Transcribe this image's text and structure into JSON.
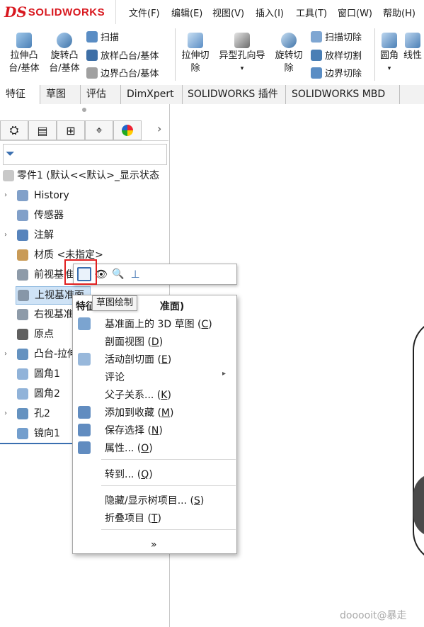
{
  "app": {
    "logo_ds": "DS",
    "logo_text": "SOLIDWORKS",
    "brand_color": "#d8181f"
  },
  "menubar": [
    "文件(F)",
    "编辑(E)",
    "视图(V)",
    "插入(I)",
    "工具(T)",
    "窗口(W)",
    "帮助(H)"
  ],
  "ribbon": {
    "extrude_boss": [
      "拉伸凸",
      "台/基体"
    ],
    "revolve_boss": [
      "旋转凸",
      "台/基体"
    ],
    "sweep": "扫描",
    "loft": "放样凸台/基体",
    "boundary": "边界凸台/基体",
    "extrude_cut": [
      "拉伸切",
      "除"
    ],
    "hole_wizard": "异型孔向导",
    "revolve_cut": [
      "旋转切",
      "除"
    ],
    "sweep_cut": "扫描切除",
    "loft_cut": "放样切割",
    "boundary_cut": "边界切除",
    "fillet": "圆角",
    "linear_pattern": "线性"
  },
  "tabs": [
    "特征",
    "草图",
    "评估",
    "DimXpert",
    "SOLIDWORKS 插件",
    "SOLIDWORKS MBD"
  ],
  "tree": {
    "root": "零件1  (默认<<默认>_显示状态",
    "items": [
      {
        "label": "History",
        "arrow": "›"
      },
      {
        "label": "传感器",
        "arrow": ""
      },
      {
        "label": "注解",
        "arrow": "›"
      },
      {
        "label": "材质 <未指定>",
        "arrow": ""
      },
      {
        "label": "前视基准",
        "arrow": ""
      },
      {
        "label": "上视基准面",
        "arrow": ""
      },
      {
        "label": "右视基准",
        "arrow": ""
      },
      {
        "label": "原点",
        "arrow": ""
      },
      {
        "label": "凸台-拉伸",
        "arrow": "›"
      },
      {
        "label": "圆角1",
        "arrow": ""
      },
      {
        "label": "圆角2",
        "arrow": ""
      },
      {
        "label": "孔2",
        "arrow": "›"
      },
      {
        "label": "镜向1",
        "arrow": ""
      }
    ]
  },
  "tooltip": "草图绘制",
  "menu": {
    "header_prefix": "特征",
    "header_suffix": "准面)",
    "items": [
      {
        "label": "基准面上的 3D 草图 (",
        "key": "C",
        "tail": ")",
        "icon": "3d-sketch-icon"
      },
      {
        "label": "剖面视图 (",
        "key": "D",
        "tail": ")",
        "icon": ""
      },
      {
        "label": "活动剖切面 (",
        "key": "E",
        "tail": ")",
        "icon": "section-plane-icon"
      },
      {
        "label": "评论",
        "key": "",
        "tail": "",
        "icon": ""
      },
      {
        "label": "父子关系... (",
        "key": "K",
        "tail": ")",
        "icon": ""
      },
      {
        "label": "添加到收藏 (",
        "key": "M",
        "tail": ")",
        "icon": "favorite-icon"
      },
      {
        "label": "保存选择 (",
        "key": "N",
        "tail": ")",
        "icon": "save-selection-icon"
      },
      {
        "label": "属性... (",
        "key": "O",
        "tail": ")",
        "icon": "properties-icon"
      },
      {
        "label": "转到... (",
        "key": "Q",
        "tail": ")",
        "icon": ""
      },
      {
        "label": "隐藏/显示树项目... (",
        "key": "S",
        "tail": ")",
        "icon": ""
      },
      {
        "label": "折叠项目 (",
        "key": "T",
        "tail": ")",
        "icon": ""
      }
    ],
    "more": "»"
  },
  "watermark": "dooooit@暴走"
}
